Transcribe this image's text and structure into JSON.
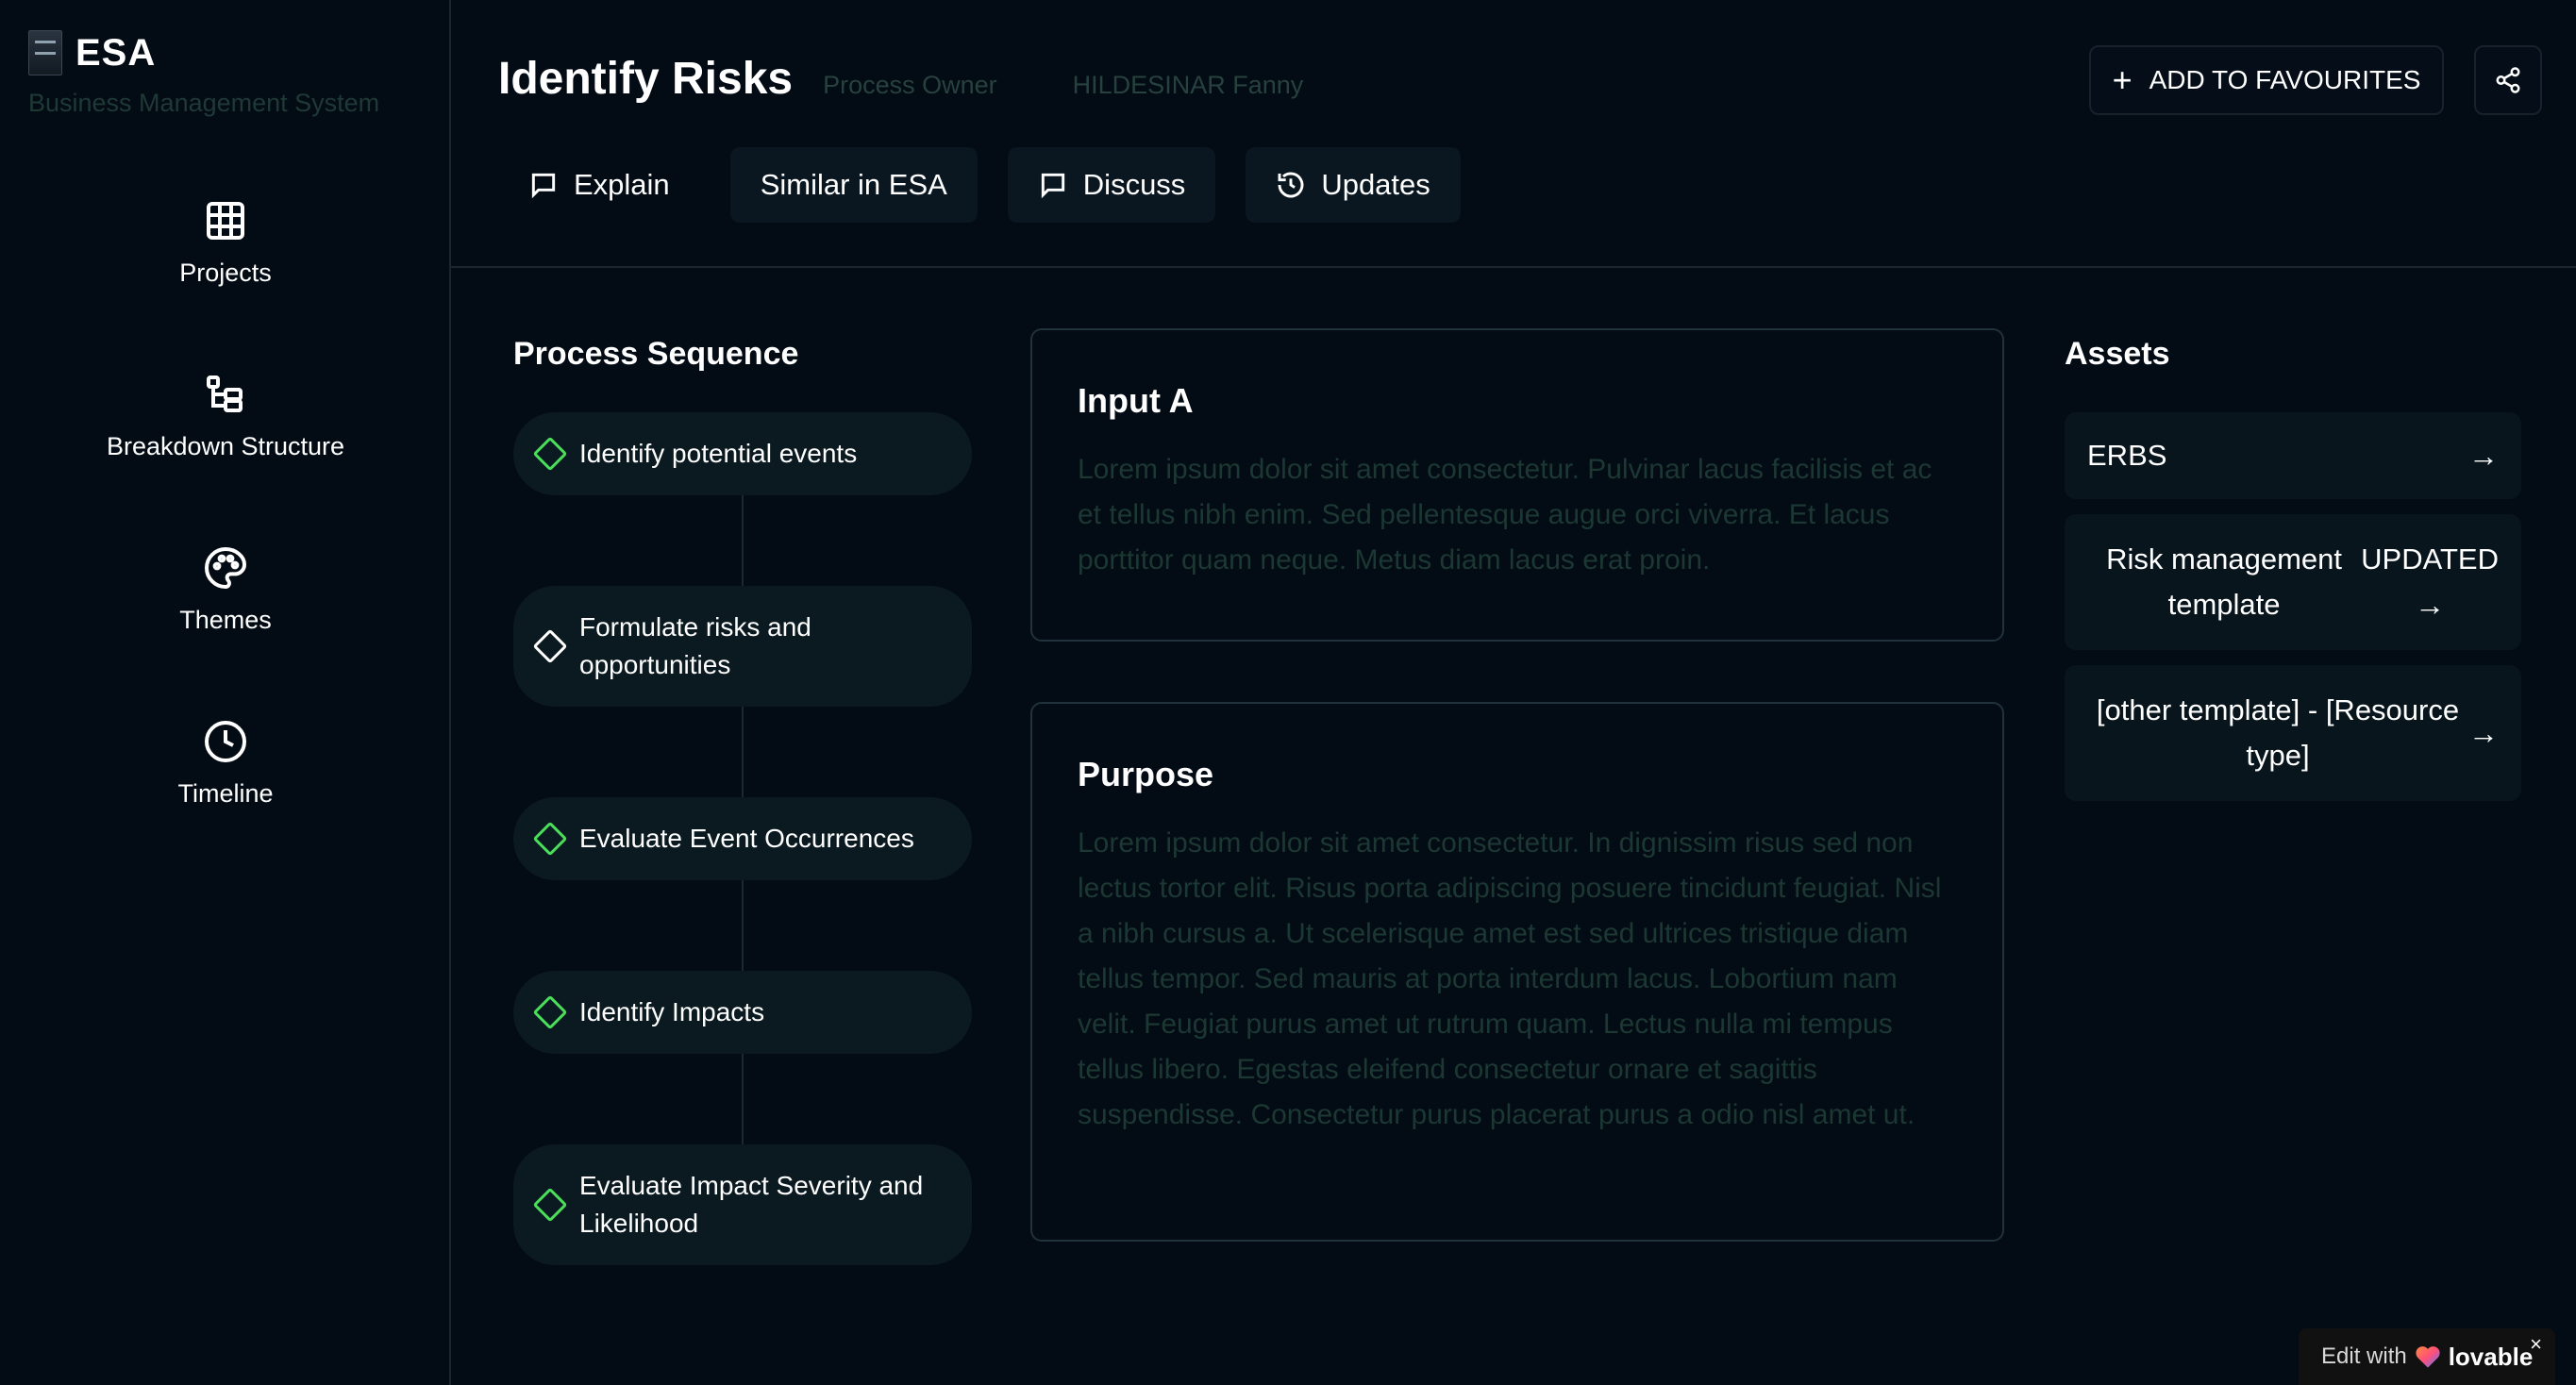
{
  "brand": {
    "name": "ESA",
    "subtitle": "Business Management System"
  },
  "sidebar": {
    "items": [
      {
        "label": "Projects",
        "icon": "grid-icon"
      },
      {
        "label": "Breakdown Structure",
        "icon": "hierarchy-icon"
      },
      {
        "label": "Themes",
        "icon": "palette-icon"
      },
      {
        "label": "Timeline",
        "icon": "clock-icon"
      }
    ]
  },
  "header": {
    "title": "Identify Risks",
    "owner_label": "Process Owner",
    "owner_name": "HILDESINAR Fanny",
    "favourite_label": "ADD TO FAVOURITES",
    "share_icon": "share-icon",
    "tabs": [
      {
        "label": "Explain",
        "icon": "message-icon"
      },
      {
        "label": "Similar in ESA",
        "icon": ""
      },
      {
        "label": "Discuss",
        "icon": "message-icon"
      },
      {
        "label": "Updates",
        "icon": "history-icon"
      }
    ]
  },
  "process": {
    "title": "Process Sequence",
    "steps": [
      {
        "label": "Identify potential events",
        "status": "active"
      },
      {
        "label": "Formulate risks and opportunities",
        "status": "current"
      },
      {
        "label": "Evaluate Event Occurrences",
        "status": "active"
      },
      {
        "label": "Identify Impacts",
        "status": "active"
      },
      {
        "label": "Evaluate Impact Severity and Likelihood",
        "status": "active"
      }
    ]
  },
  "cards": {
    "input": {
      "title": "Input A",
      "body": "Lorem ipsum dolor sit amet consectetur. Pulvinar lacus facilisis et ac et tellus nibh enim. Sed pellentesque augue orci viverra. Et lacus porttitor quam neque. Metus diam lacus erat proin."
    },
    "purpose": {
      "title": "Purpose",
      "body": "Lorem ipsum dolor sit amet consectetur. In dignissim risus sed non lectus tortor elit. Risus porta adipiscing posuere tincidunt feugiat. Nisl a nibh cursus a. Ut scelerisque amet est sed ultrices tristique diam tellus tempor. Sed mauris at porta interdum lacus. Lobortium nam velit. Feugiat purus amet ut rutrum quam. Lectus nulla mi tempus tellus libero. Egestas eleifend consectetur ornare et sagittis suspendisse. Consectetur purus placerat purus a odio nisl amet ut."
    }
  },
  "assets": {
    "title": "Assets",
    "items": [
      {
        "label": "ERBS",
        "tag": "",
        "arrow": "→"
      },
      {
        "label": "Risk management template",
        "tag": "UPDATED",
        "arrow": "→"
      },
      {
        "label": "[other template] - [Resource type]",
        "tag": "",
        "arrow": "→"
      }
    ]
  },
  "badge": {
    "prefix": "Edit with",
    "brand": "lovable",
    "close": "×"
  },
  "colors": {
    "background": "#030b14",
    "accent_green": "#4ade5a",
    "muted_text": "#1c3833"
  }
}
